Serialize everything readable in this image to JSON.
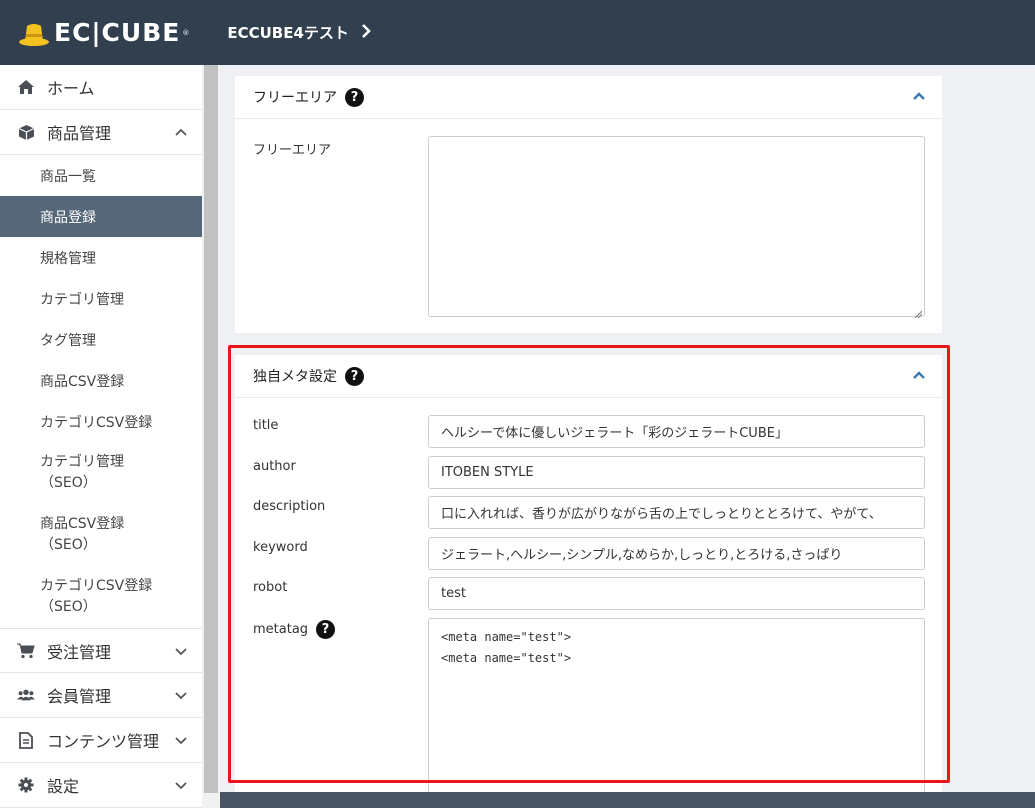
{
  "header": {
    "logo_text": "EC|CUBE",
    "logo_reg": "®",
    "shop_name": "ECCUBE4テスト",
    "chevron": "›"
  },
  "sidebar": {
    "home": "ホーム",
    "products": "商品管理",
    "product_items": [
      {
        "label": "商品一覧"
      },
      {
        "label": "商品登録",
        "active": true
      },
      {
        "label": "規格管理"
      },
      {
        "label": "カテゴリ管理"
      },
      {
        "label": "タグ管理"
      },
      {
        "label": "商品CSV登録"
      },
      {
        "label": "カテゴリCSV登録"
      },
      {
        "label": "カテゴリ管理",
        "sub": "（SEO）"
      },
      {
        "label": "商品CSV登録",
        "sub": "（SEO）"
      },
      {
        "label": "カテゴリCSV登録",
        "sub": "（SEO）"
      }
    ],
    "orders": "受注管理",
    "members": "会員管理",
    "contents": "コンテンツ管理",
    "settings": "設定"
  },
  "free_area": {
    "title": "フリーエリア",
    "field_label": "フリーエリア",
    "value": ""
  },
  "meta": {
    "title": "独自メタ設定",
    "labels": {
      "title": "title",
      "author": "author",
      "description": "description",
      "keyword": "keyword",
      "robot": "robot",
      "metatag": "metatag"
    },
    "values": {
      "title": "ヘルシーで体に優しいジェラート「彩のジェラートCUBE」",
      "author": "ITOBEN STYLE",
      "description": "口に入れれば、香りが広がりながら舌の上でしっとりととろけて、やがて、",
      "keyword": "ジェラート,ヘルシー,シンプル,なめらか,しっとり,とろける,さっぱり",
      "robot": "test",
      "metatag_line1": "<meta name=\"test\">",
      "metatag_line2": "<meta name=\"test\">"
    }
  },
  "colors": {
    "header_bg": "#313f4e",
    "active_nav": "#56677a",
    "highlight": "#e8161b"
  }
}
